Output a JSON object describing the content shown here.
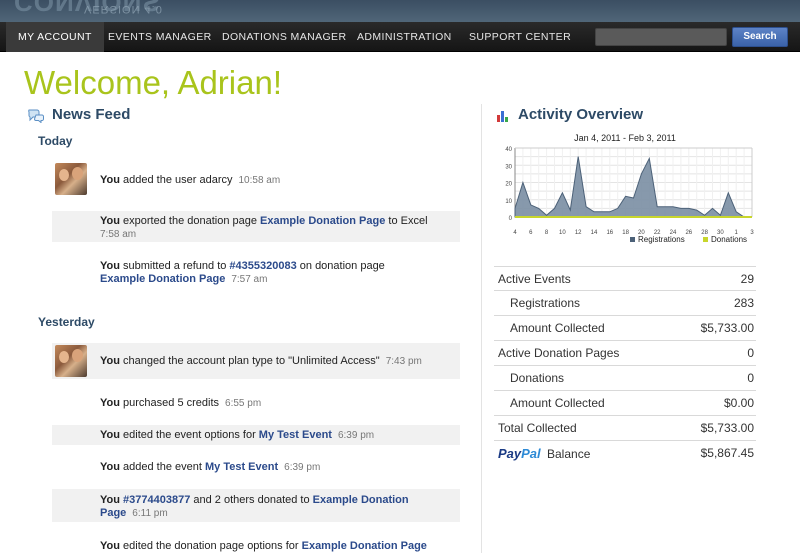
{
  "header": {
    "logo_ghost": "CONVIONS",
    "logo_version": "VERSION 4.0"
  },
  "nav": {
    "items": [
      {
        "label": "MY ACCOUNT",
        "active": true
      },
      {
        "label": "EVENTS MANAGER",
        "active": false
      },
      {
        "label": "DONATIONS MANAGER",
        "active": false
      },
      {
        "label": "ADMINISTRATION",
        "active": false
      },
      {
        "label": "SUPPORT CENTER",
        "active": false
      }
    ],
    "search": {
      "value": "",
      "placeholder": "",
      "button_label": "Search"
    }
  },
  "welcome": "Welcome, Adrian!",
  "news_feed": {
    "title": "News Feed",
    "icon": "speech-bubbles-icon",
    "groups": [
      {
        "label": "Today",
        "items": [
          {
            "you": "You",
            "pre": " added the user adarcy",
            "time": "10:58 am"
          },
          {
            "you": "You",
            "pre": " exported the donation page ",
            "link": "Example Donation Page",
            "post": " to Excel",
            "time": "7:58 am"
          },
          {
            "you": "You",
            "pre": " submitted a refund to ",
            "link": "#4355320083",
            "post": " on donation page ",
            "link2": "Example Donation Page",
            "time": "7:57 am"
          }
        ]
      },
      {
        "label": "Yesterday",
        "items": [
          {
            "you": "You",
            "pre": " changed the account plan type to \"Unlimited Access\"",
            "time": "7:43 pm"
          },
          {
            "you": "You",
            "pre": " purchased 5 credits",
            "time": "6:55 pm"
          },
          {
            "you": "You",
            "pre": " edited the event options for ",
            "link": "My Test Event",
            "time": "6:39 pm"
          },
          {
            "you": "You",
            "pre": " added the event ",
            "link": "My Test Event",
            "time": "6:39 pm"
          },
          {
            "you": "You",
            "pre": " ",
            "link": "#3774403877",
            "post": " and 2 others donated to ",
            "link2": "Example Donation Page",
            "time": "6:11 pm"
          },
          {
            "you": "You",
            "pre": " edited the donation page options for ",
            "link": "Example Donation Page",
            "time": ""
          }
        ]
      }
    ]
  },
  "activity": {
    "title": "Activity Overview",
    "icon": "bar-chart-icon",
    "stats": [
      {
        "label": "Active Events",
        "value": "29",
        "indent": false
      },
      {
        "label": "Registrations",
        "value": "283",
        "indent": true
      },
      {
        "label": "Amount Collected",
        "value": "$5,733.00",
        "indent": true
      },
      {
        "label": "Active Donation Pages",
        "value": "0",
        "indent": false
      },
      {
        "label": "Donations",
        "value": "0",
        "indent": true
      },
      {
        "label": "Amount Collected",
        "value": "$0.00",
        "indent": true
      },
      {
        "label": "Total Collected",
        "value": "$5,733.00",
        "indent": false
      }
    ],
    "paypal": {
      "word1": "Pay",
      "word2": "Pal",
      "label": "Balance",
      "value": "$5,867.45"
    }
  },
  "chart_data": {
    "type": "area",
    "title": "Jan 4, 2011 - Feb 3, 2011",
    "x": [
      4,
      5,
      6,
      7,
      8,
      9,
      10,
      11,
      12,
      13,
      14,
      15,
      16,
      17,
      18,
      19,
      20,
      21,
      22,
      23,
      24,
      25,
      26,
      27,
      28,
      29,
      30,
      31,
      1,
      2,
      3
    ],
    "x_tick_labels": [
      "4",
      "6",
      "8",
      "10",
      "12",
      "14",
      "16",
      "18",
      "20",
      "22",
      "24",
      "26",
      "28",
      "30",
      "1",
      "3"
    ],
    "ylim": [
      0,
      40
    ],
    "y_ticks": [
      0,
      5,
      10,
      15,
      20,
      25,
      30,
      35,
      40
    ],
    "series": [
      {
        "name": "Registrations",
        "color": "#7a8ea3",
        "values": [
          5,
          20,
          7,
          5,
          1,
          5,
          14,
          4,
          35,
          6,
          3,
          3,
          3,
          5,
          12,
          11,
          25,
          34,
          6,
          6,
          6,
          5,
          5,
          4,
          1,
          5,
          1,
          14,
          3,
          0,
          0
        ]
      },
      {
        "name": "Donations",
        "color": "#c8d62c",
        "values": [
          0,
          0,
          0,
          0,
          0,
          0,
          0,
          0,
          0,
          0,
          0,
          0,
          0,
          0,
          0,
          0,
          0,
          0,
          0,
          0,
          0,
          0,
          0,
          0,
          0,
          0,
          0,
          0,
          0,
          0,
          0
        ]
      }
    ],
    "legend_position": "bottom-right",
    "grid": true
  }
}
